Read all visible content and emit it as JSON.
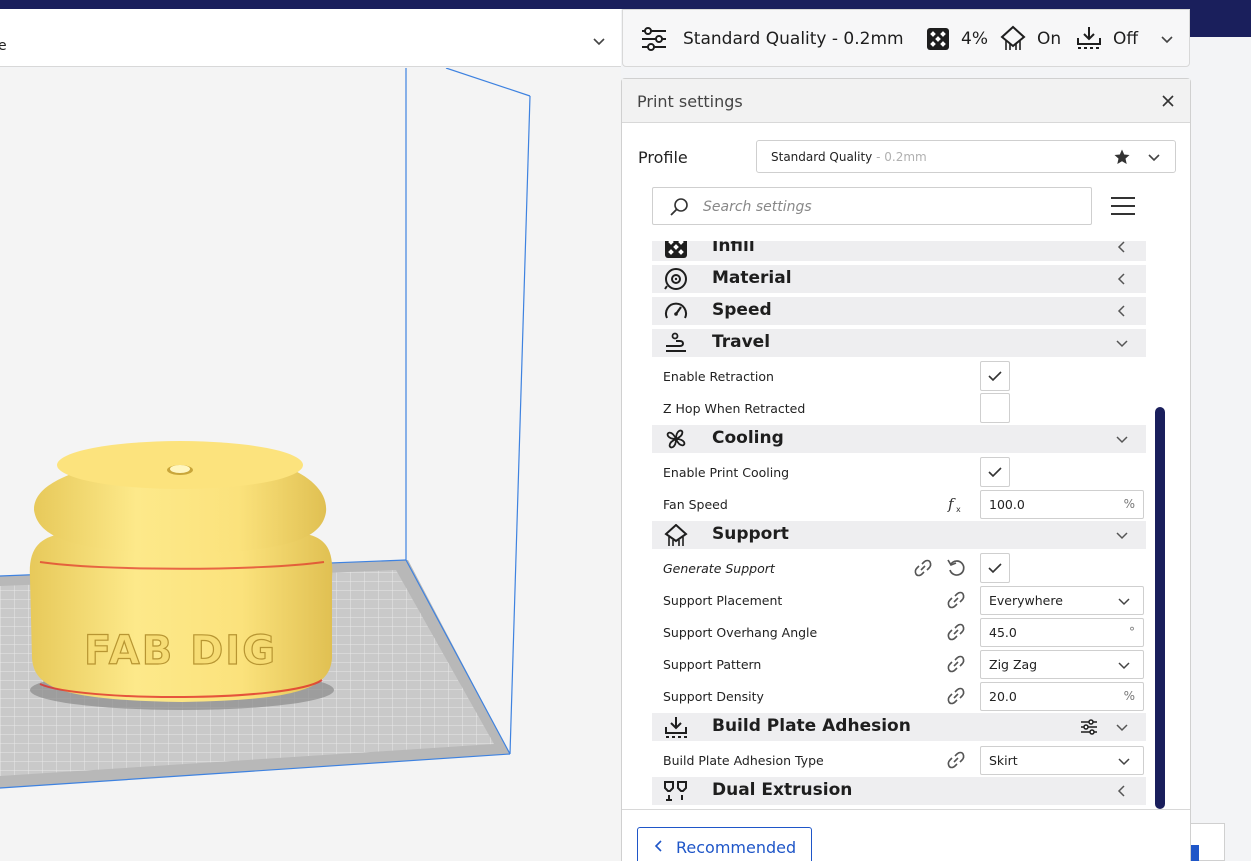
{
  "machine": {
    "name": "e"
  },
  "quality_bar": {
    "profile": "Standard Quality - 0.2mm",
    "infill": "4%",
    "support": "On",
    "adhesion": "Off"
  },
  "model": {
    "text": "FAB DIG",
    "color": "#fde98a"
  },
  "panel": {
    "title": "Print settings",
    "profile_label": "Profile",
    "profile_main": "Standard Quality",
    "profile_sub": " - 0.2mm",
    "search_placeholder": "Search settings",
    "footer_button": "Recommended"
  },
  "categories": {
    "infill": "Infill",
    "material": "Material",
    "speed": "Speed",
    "travel": "Travel",
    "cooling": "Cooling",
    "support": "Support",
    "adhesion": "Build Plate Adhesion",
    "dual": "Dual Extrusion"
  },
  "settings": {
    "enable_retraction": {
      "label": "Enable Retraction",
      "checked": true
    },
    "z_hop": {
      "label": "Z Hop When Retracted",
      "checked": false
    },
    "enable_cooling": {
      "label": "Enable Print Cooling",
      "checked": true
    },
    "fan_speed": {
      "label": "Fan Speed",
      "value": "100.0",
      "unit": "%"
    },
    "generate_support": {
      "label": "Generate Support",
      "checked": true
    },
    "support_placement": {
      "label": "Support Placement",
      "value": "Everywhere"
    },
    "overhang_angle": {
      "label": "Support Overhang Angle",
      "value": "45.0",
      "unit": "°"
    },
    "support_pattern": {
      "label": "Support Pattern",
      "value": "Zig Zag"
    },
    "support_density": {
      "label": "Support Density",
      "value": "20.0",
      "unit": "%"
    },
    "adhesion_type": {
      "label": "Build Plate Adhesion Type",
      "value": "Skirt"
    }
  },
  "colors": {
    "accent": "#1f56c8",
    "header": "#1a1f5c"
  }
}
